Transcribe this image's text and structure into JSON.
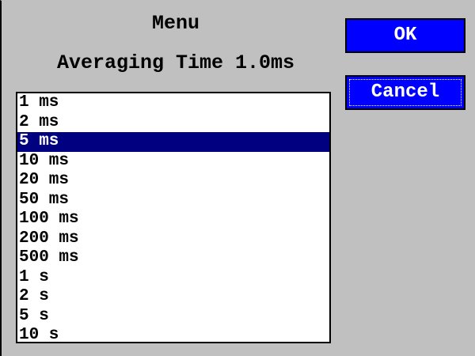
{
  "dialog": {
    "title": "Menu",
    "subtitle": "Averaging Time 1.0ms"
  },
  "list": {
    "selected_index": 2,
    "items": [
      {
        "label": "1 ms"
      },
      {
        "label": "2 ms"
      },
      {
        "label": "5 ms"
      },
      {
        "label": "10 ms"
      },
      {
        "label": "20 ms"
      },
      {
        "label": "50 ms"
      },
      {
        "label": "100 ms"
      },
      {
        "label": "200 ms"
      },
      {
        "label": "500 ms"
      },
      {
        "label": "1 s"
      },
      {
        "label": "2 s"
      },
      {
        "label": "5 s"
      },
      {
        "label": "10 s"
      }
    ]
  },
  "buttons": {
    "ok_label": "OK",
    "cancel_label": "Cancel"
  },
  "colors": {
    "dialog_background": "#c0c0c0",
    "button_blue": "#0000ff",
    "selection_navy": "#000080",
    "list_background": "#ffffff"
  }
}
